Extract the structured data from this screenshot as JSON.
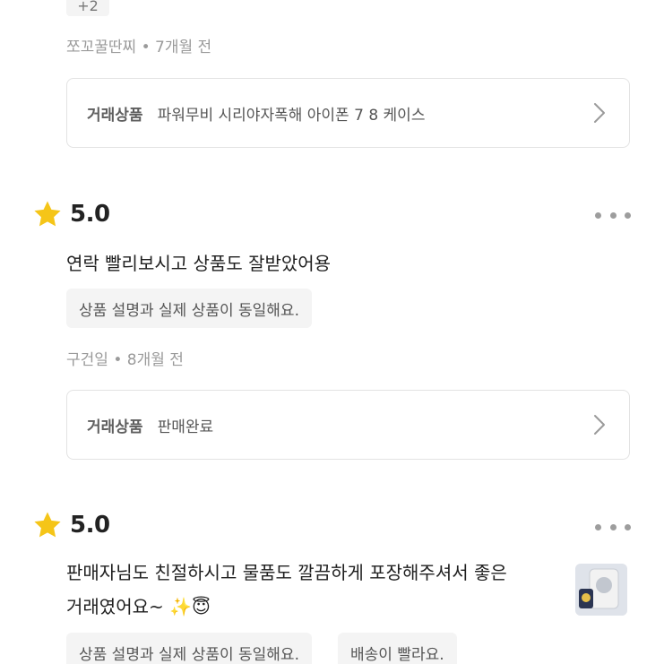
{
  "top_partial": {
    "tag_text": "+2",
    "meta": "쪼꼬꿀딴찌 • 7개월 전",
    "product_label": "거래상품",
    "product_name": "파워무비 시리야자폭해 아이폰 7 8 케이스"
  },
  "reviews": [
    {
      "rating": "5.0",
      "text_lines": [
        "연락 빨리보시고 상품도 잘받았어용"
      ],
      "tags": [
        "상품 설명과 실제 상품이 동일해요."
      ],
      "meta": "구건일 • 8개월 전",
      "product_label": "거래상품",
      "product_name": "판매완료"
    },
    {
      "rating": "5.0",
      "text_lines": [
        "판매자님도 친절하시고 물품도 깔끔하게 포장해주셔서 좋은",
        "거래였어요~ ✨😇"
      ],
      "tags": [
        "상품 설명과 실제 상품이 동일해요.",
        "배송이 빨라요."
      ]
    }
  ],
  "colors": {
    "star": "#f5c518",
    "border": "#e3e3e3",
    "chip_bg": "#f4f4f4",
    "meta_text": "#9a9a9a"
  },
  "icons": [
    "star-icon",
    "more-icon",
    "chevron-right-icon"
  ]
}
